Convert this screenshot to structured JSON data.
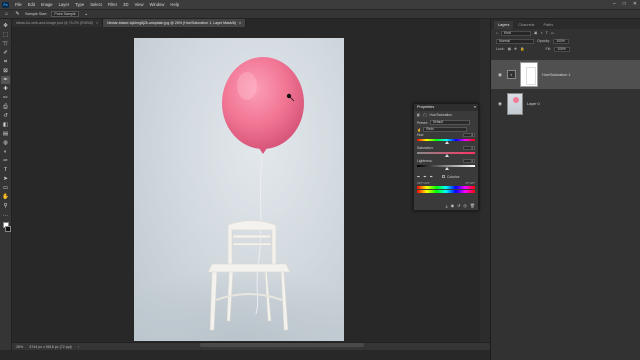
{
  "menubar": {
    "app_badge": "Ps",
    "items": [
      "File",
      "Edit",
      "Image",
      "Layer",
      "Type",
      "Select",
      "Filter",
      "3D",
      "View",
      "Window",
      "Help"
    ]
  },
  "options_bar": {
    "sample_label": "Sample Size:",
    "sample_value": "Point Sample"
  },
  "tabs": [
    {
      "label": "Ideas-for-web-and-image.psd @ 75.2% (RGB/8)",
      "active": false
    },
    {
      "label": "Nectar-blaser-tqiUmg8j2k-unsplash.jpg @ 26% (Hue/Saturation 1, Layer Mask/8)",
      "active": true
    }
  ],
  "status": {
    "zoom": "26%",
    "doc_size": "3744 px x 5616 px (72 ppi)"
  },
  "layers_panel": {
    "tabs": [
      "Layers",
      "Channels",
      "Paths"
    ],
    "search_placeholder": "Kind",
    "blend_mode": "Normal",
    "opacity_label": "Opacity:",
    "opacity_value": "100%",
    "lock_label": "Lock:",
    "fill_label": "Fill:",
    "fill_value": "100%",
    "layers": [
      {
        "name": "Hue/Saturation 1",
        "selected": true
      },
      {
        "name": "Layer 0",
        "selected": false
      }
    ]
  },
  "properties": {
    "title": "Properties",
    "subtitle": "Hue/Saturation",
    "preset_label": "Preset:",
    "preset_value": "Default",
    "channel_value": "Reds",
    "hue_label": "Hue:",
    "hue_value": "0",
    "saturation_label": "Saturation:",
    "saturation_value": "0",
    "lightness_label": "Lightness:",
    "lightness_value": "0",
    "colorize_label": "Colorize",
    "range_left": "345°/315°",
    "range_right": "15°\\45°"
  }
}
